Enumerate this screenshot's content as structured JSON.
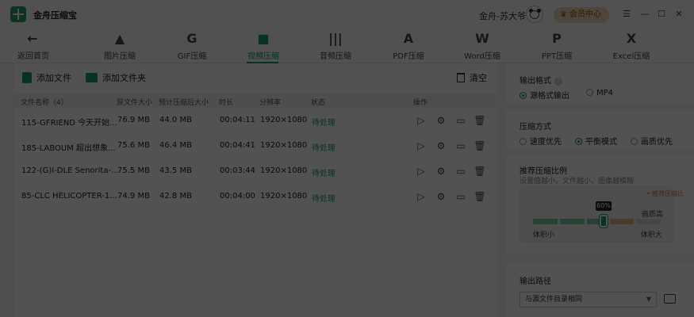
{
  "app": {
    "title": "金舟压缩宝"
  },
  "user": {
    "name": "金舟-苏大爷",
    "vip_label": "会员中心"
  },
  "window": {
    "menu_glyph": "☰",
    "minimize_glyph": "—",
    "maximize_glyph": "☐",
    "close_glyph": "✕"
  },
  "toolbar": {
    "items": [
      {
        "label": "返回首页",
        "icon": "back-arrow-icon",
        "glyph": "←"
      },
      {
        "label": "图片压缩",
        "icon": "image-icon",
        "glyph": "▲"
      },
      {
        "label": "GIF压缩",
        "icon": "gif-icon",
        "glyph": "G"
      },
      {
        "label": "视频压缩",
        "icon": "video-icon",
        "glyph": "■"
      },
      {
        "label": "音频压缩",
        "icon": "audio-icon",
        "glyph": "|||"
      },
      {
        "label": "PDF压缩",
        "icon": "pdf-icon",
        "glyph": "A"
      },
      {
        "label": "Word压缩",
        "icon": "word-icon",
        "glyph": "W"
      },
      {
        "label": "PPT压缩",
        "icon": "ppt-icon",
        "glyph": "P"
      },
      {
        "label": "Excel压缩",
        "icon": "excel-icon",
        "glyph": "X"
      }
    ],
    "active": "视频压缩"
  },
  "actions": {
    "add_file": "添加文件",
    "add_folder": "添加文件夹",
    "clear": "清空"
  },
  "table": {
    "headers": [
      "文件名称（4）",
      "原文件大小",
      "预计压缩后大小",
      "时长",
      "分辨率",
      "状态",
      "操作"
    ],
    "rows": [
      {
        "name": "115-GFRIEND 今天开始...",
        "orig": "76.9 MB",
        "est": "44.0 MB",
        "duration": "00:04:11",
        "res": "1920×1080",
        "status": "待处理"
      },
      {
        "name": "185-LABOUM 超出想象...",
        "orig": "75.6 MB",
        "est": "46.4 MB",
        "duration": "00:04:41",
        "res": "1920×1080",
        "status": "待处理"
      },
      {
        "name": "122-(G)I-DLE Senorita-...",
        "orig": "75.5 MB",
        "est": "43.5 MB",
        "duration": "00:03:44",
        "res": "1920×1080",
        "status": "待处理"
      },
      {
        "name": "85-CLC HELICOPTER-1...",
        "orig": "74.9 MB",
        "est": "42.8 MB",
        "duration": "00:04:00",
        "res": "1920×1080",
        "status": "待处理"
      }
    ]
  },
  "settings": {
    "output_format": {
      "title": "输出格式",
      "options": [
        "源格式输出",
        "MP4"
      ],
      "selected": "源格式输出"
    },
    "compress_mode": {
      "title": "压缩方式",
      "options": [
        "速度优先",
        "平衡模式",
        "画质优先"
      ],
      "selected": "平衡模式"
    },
    "ratio": {
      "title": "推荐压缩比例",
      "hint": "设置值越小，文件越小，图像越模糊",
      "recommend": "• 推荐压缩比",
      "value_label": "60%",
      "value": 0.6,
      "quality_high": "画质高",
      "size_small": "体积小",
      "size_big": "体积大"
    },
    "output_path": {
      "title": "输出路径",
      "value": "与源文件目录相同"
    }
  },
  "colors": {
    "accent": "#1a9c6c",
    "recommend": "#e07b22",
    "vip_bg": "#ecd9b8"
  }
}
